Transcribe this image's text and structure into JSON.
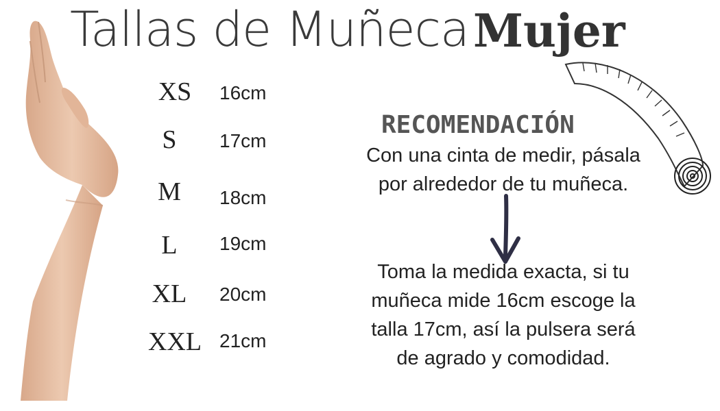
{
  "header": {
    "title": "Tallas de Muñeca",
    "title_bold": "Mujer"
  },
  "sizes": [
    {
      "label": "XS",
      "value": "16cm"
    },
    {
      "label": "S",
      "value": "17cm"
    },
    {
      "label": "M",
      "value": "18cm"
    },
    {
      "label": "L",
      "value": "19cm"
    },
    {
      "label": "XL",
      "value": "20cm"
    },
    {
      "label": "XXL",
      "value": "21cm"
    }
  ],
  "recommendation": {
    "title": "RECOMENDACIÓN",
    "line1": "Con una cinta de medir, pásala",
    "line2": "por alrededor de tu muñeca.",
    "step2_line1": "Toma la medida exacta, si tu",
    "step2_line2": "muñeca mide 16cm escoge la",
    "step2_line3": "talla 17cm, así la pulsera será",
    "step2_line4": "de agrado y comodidad."
  },
  "icons": {
    "arm": "arm-hand-photo",
    "tape": "measuring-tape-icon",
    "arrow": "arrow-down-icon"
  },
  "colors": {
    "skin": "#e8c2a6",
    "skin_shadow": "#c99b7e",
    "arrow": "#2f2f45",
    "text": "#222222"
  }
}
